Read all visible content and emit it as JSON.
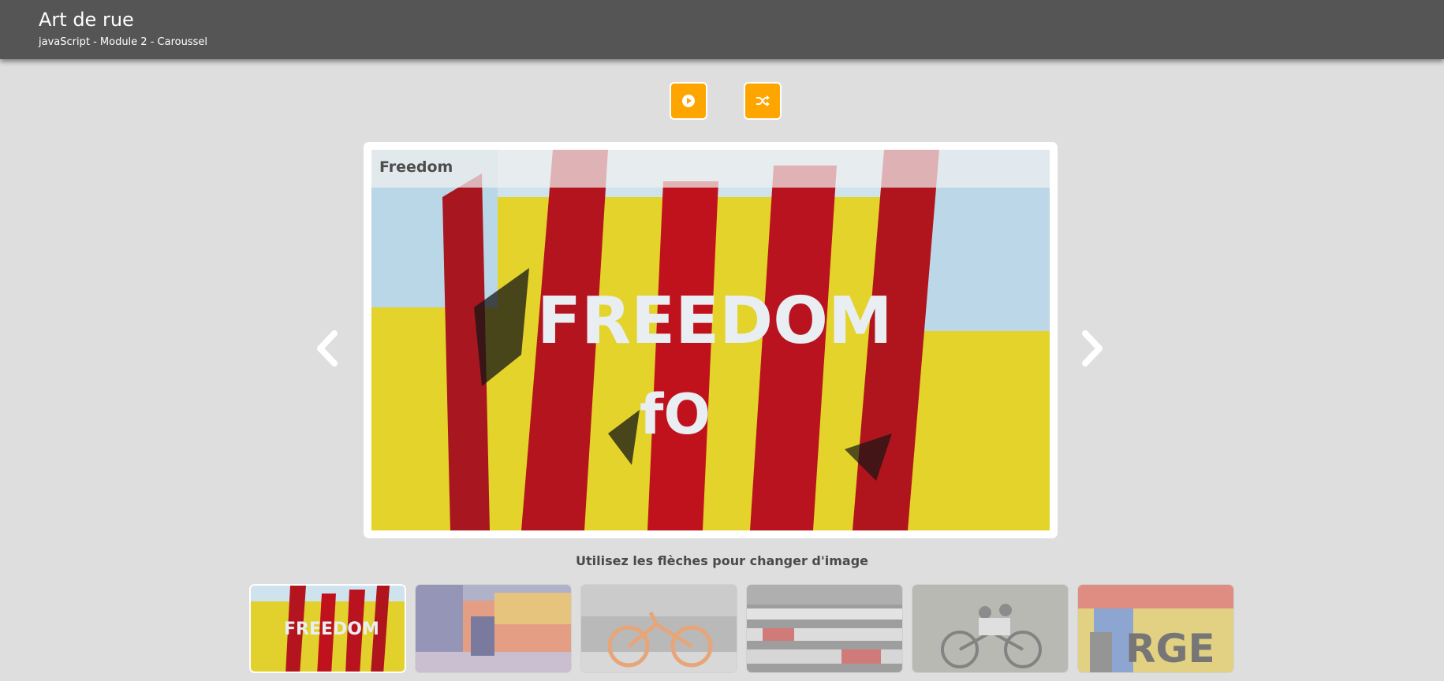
{
  "header": {
    "title": "Art de rue",
    "subtitle": "javaScript - Module 2 - Caroussel"
  },
  "controls": {
    "play_icon": "play-circle-icon",
    "shuffle_icon": "shuffle-icon",
    "accent": "#ffa500"
  },
  "slide": {
    "caption": "Freedom",
    "image_text": "FREEDOM"
  },
  "nav": {
    "prev_icon": "chevron-left-icon",
    "next_icon": "chevron-right-icon"
  },
  "instruction": "Utilisez les flèches pour changer d'image",
  "thumbnails": [
    {
      "subject": "freedom graffiti wall",
      "active": true
    },
    {
      "subject": "graffiti alley",
      "active": false
    },
    {
      "subject": "orange bicycle",
      "active": false
    },
    {
      "subject": "painted stairs",
      "active": false
    },
    {
      "subject": "children on bicycle mural",
      "active": false
    },
    {
      "subject": "graffiti lettering",
      "active": false
    }
  ]
}
